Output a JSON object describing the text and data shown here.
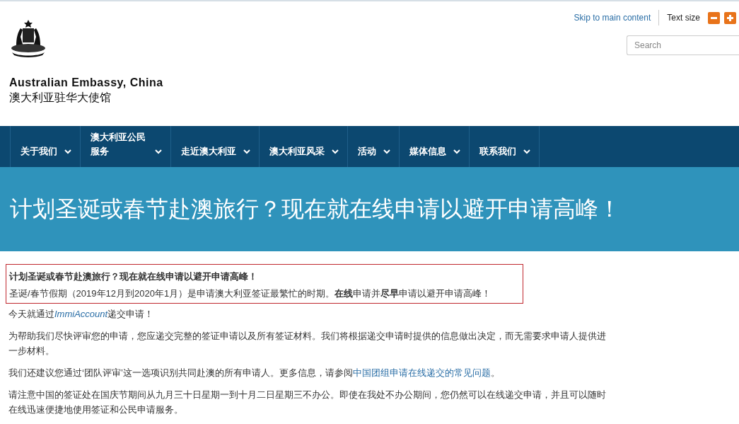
{
  "header": {
    "skip_link": "Skip to main content",
    "text_size_label": "Text size",
    "search": {
      "placeholder": "Search"
    },
    "site_name": "Australian Embassy, China",
    "site_name_cn": "澳大利亚驻华大使馆"
  },
  "nav": {
    "items": [
      {
        "label": "关于我们"
      },
      {
        "label": "澳大利亚公民服务"
      },
      {
        "label": "走近澳大利亚"
      },
      {
        "label": "澳大利亚风采"
      },
      {
        "label": "活动"
      },
      {
        "label": "媒体信息"
      },
      {
        "label": "联系我们"
      }
    ]
  },
  "banner": {
    "title": "计划圣诞或春节赴澳旅行？现在就在线申请以避开申请高峰！"
  },
  "notice": {
    "title": "计划圣诞或春节赴澳旅行？现在就在线申请以避开申请高峰！",
    "text": "圣诞/春节假期（2019年12月到2020年1月）是申请澳大利亚签证最繁忙的时期。**在线**申请并**尽早**申请以避开申请高峰！"
  },
  "paragraphs": [
    {
      "before": "今天就通过",
      "link": "ImmiAccount",
      "after": "递交申请！"
    },
    {
      "before": "为帮助我们尽快评审您的申请，您应递交完整的签证申请以及所有签证材料。我们将根据递交申请时提供的信息做出决定，而无需要求申请人提供进一步材料。"
    },
    {
      "before": "我们还建议您通过‘团队评审’这一选项识别共同赴澳的所有申请人。更多信息，请参阅",
      "link": "中国团组申请在线递交的常见问题",
      "after": "。"
    },
    {
      "before": "请注意中国的签证处在国庆节期间从九月三十日星期一到十月二日星期三不办公。即使在我处不办公期间，您仍然可以在线递交申请，并且可以随时在线迅速便捷地使用签证和公民申请服务。"
    }
  ]
}
